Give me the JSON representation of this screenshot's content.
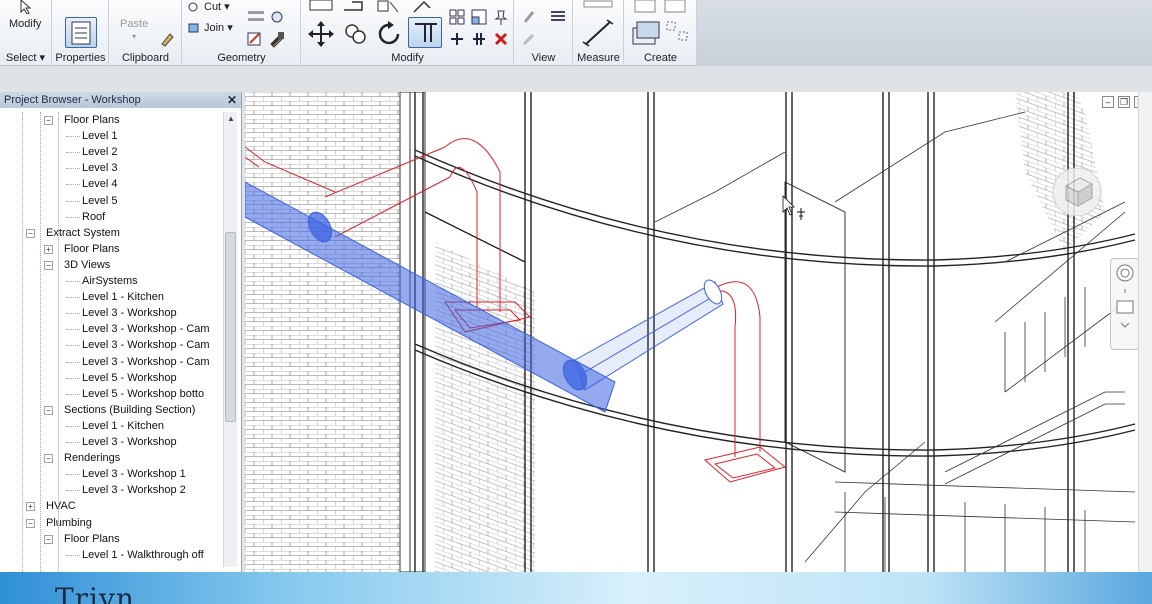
{
  "ribbon": {
    "modify_label": "Modify",
    "select_label": "Select",
    "properties_label": "Properties",
    "clipboard_label": "Clipboard",
    "paste_label": "Paste",
    "cut_label": "Cut",
    "join_label": "Join",
    "geometry_label": "Geometry",
    "modify_panel_label": "Modify",
    "view_label": "View",
    "measure_label": "Measure",
    "create_label": "Create"
  },
  "browser": {
    "title": "Project Browser - Workshop",
    "close_icon": "close-icon",
    "items": [
      {
        "label": "Floor Plans",
        "level": 1,
        "toggle": "−"
      },
      {
        "label": "Level 1",
        "level": 2
      },
      {
        "label": "Level 2",
        "level": 2
      },
      {
        "label": "Level 3",
        "level": 2
      },
      {
        "label": "Level 4",
        "level": 2
      },
      {
        "label": "Level 5",
        "level": 2
      },
      {
        "label": "Roof",
        "level": 2
      },
      {
        "label": "Extract System",
        "level": 0,
        "toggle": "−"
      },
      {
        "label": "Floor Plans",
        "level": 1,
        "toggle": "+"
      },
      {
        "label": "3D Views",
        "level": 1,
        "toggle": "−"
      },
      {
        "label": "AirSystems",
        "level": 2
      },
      {
        "label": "Level 1 - Kitchen",
        "level": 2
      },
      {
        "label": "Level 3 - Workshop",
        "level": 2
      },
      {
        "label": "Level 3 - Workshop - Cam",
        "level": 2
      },
      {
        "label": "Level 3 - Workshop - Cam",
        "level": 2
      },
      {
        "label": "Level 3 - Workshop - Cam",
        "level": 2
      },
      {
        "label": "Level 5 - Workshop",
        "level": 2
      },
      {
        "label": "Level 5 - Workshop botto",
        "level": 2
      },
      {
        "label": "Sections (Building Section)",
        "level": 1,
        "toggle": "−"
      },
      {
        "label": "Level 1 - Kitchen",
        "level": 2
      },
      {
        "label": "Level 3 - Workshop",
        "level": 2
      },
      {
        "label": "Renderings",
        "level": 1,
        "toggle": "−"
      },
      {
        "label": "Level 3 - Workshop 1",
        "level": 2
      },
      {
        "label": "Level 3 - Workshop 2",
        "level": 2
      },
      {
        "label": "HVAC",
        "level": 0,
        "toggle": "+"
      },
      {
        "label": "Plumbing",
        "level": 0,
        "toggle": "−"
      },
      {
        "label": "Floor Plans",
        "level": 1,
        "toggle": "−"
      },
      {
        "label": "Level 1 - Walkthrough off",
        "level": 2
      }
    ]
  },
  "banner": {
    "text": "Trivn"
  },
  "colors": {
    "duct_blue": "#3d63e0",
    "duct_red": "#e0202a",
    "accent": "#2f8fd6"
  }
}
